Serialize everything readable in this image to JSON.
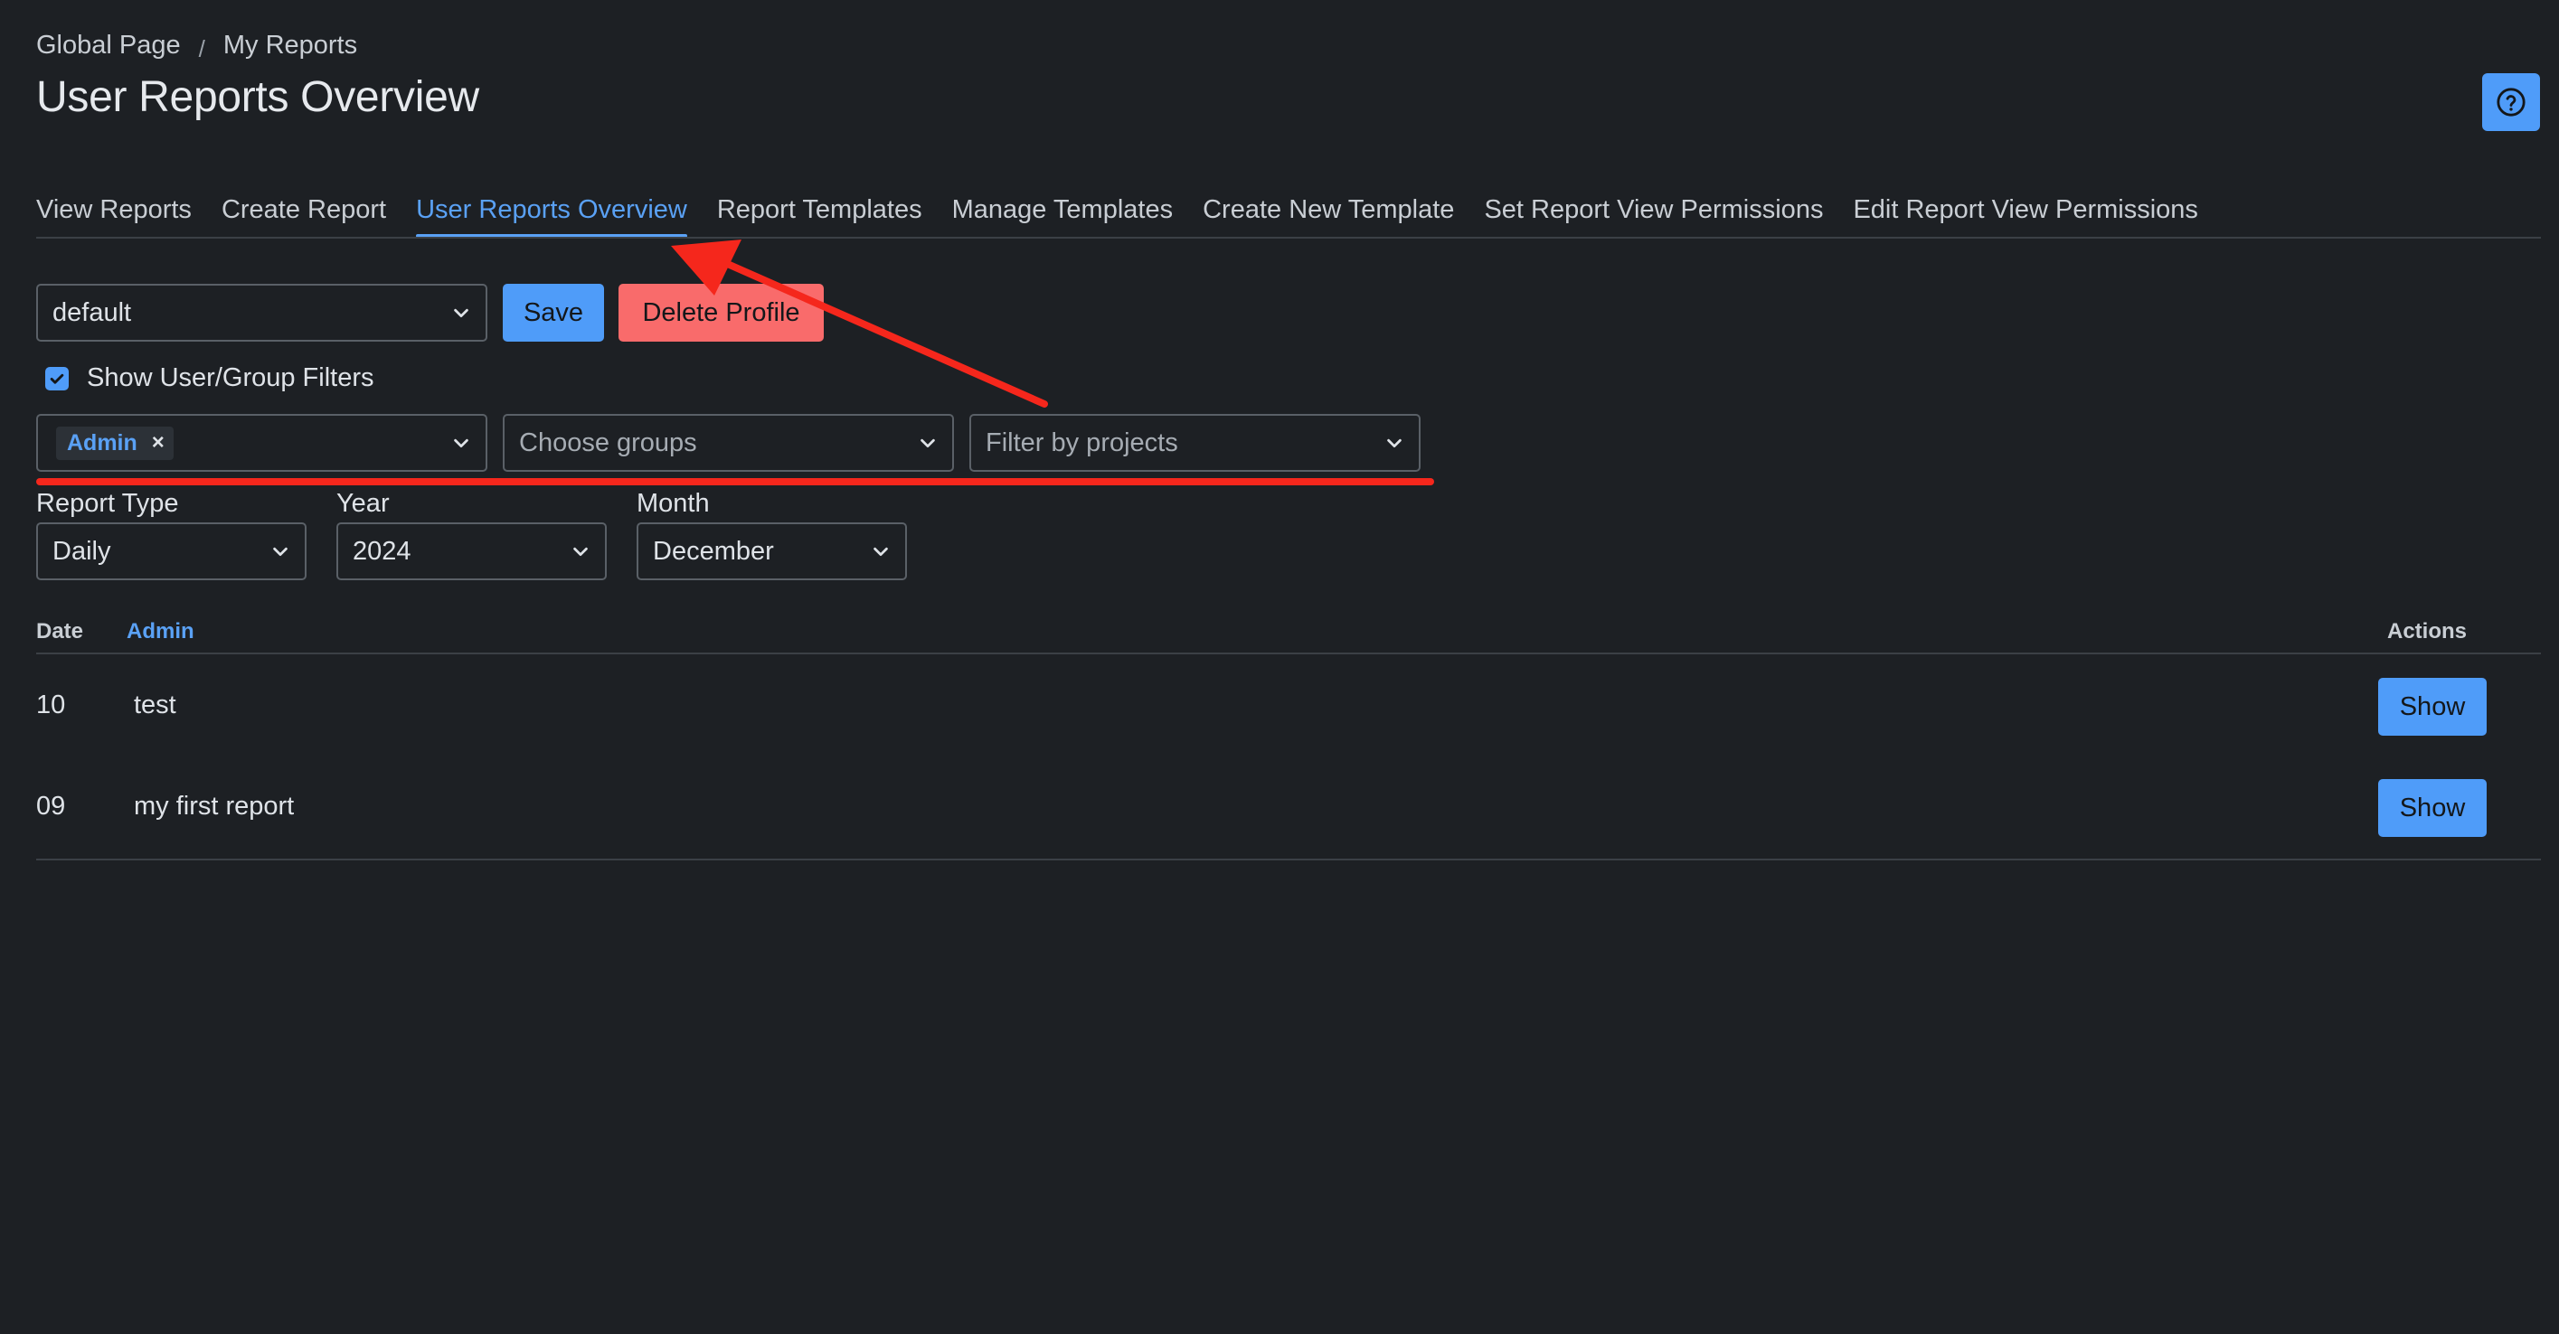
{
  "breadcrumb": {
    "items": [
      "Global Page",
      "My Reports"
    ],
    "separator": "/"
  },
  "page_title": "User Reports Overview",
  "help_icon": "question-circle-icon",
  "tabs": [
    {
      "label": "View Reports",
      "active": false
    },
    {
      "label": "Create Report",
      "active": false
    },
    {
      "label": "User Reports Overview",
      "active": true
    },
    {
      "label": "Report Templates",
      "active": false
    },
    {
      "label": "Manage Templates",
      "active": false
    },
    {
      "label": "Create New Template",
      "active": false
    },
    {
      "label": "Set Report View Permissions",
      "active": false
    },
    {
      "label": "Edit Report View Permissions",
      "active": false
    }
  ],
  "profile": {
    "selected": "default",
    "save_label": "Save",
    "delete_label": "Delete Profile"
  },
  "filters": {
    "show_filters_label": "Show User/Group Filters",
    "show_filters_checked": true,
    "users": {
      "tags": [
        "Admin"
      ],
      "remove_glyph": "×"
    },
    "groups_placeholder": "Choose groups",
    "projects_placeholder": "Filter by projects"
  },
  "report_options": {
    "type_label": "Report Type",
    "type_value": "Daily",
    "year_label": "Year",
    "year_value": "2024",
    "month_label": "Month",
    "month_value": "December"
  },
  "table": {
    "headers": {
      "date": "Date",
      "user": "Admin",
      "actions": "Actions"
    },
    "rows": [
      {
        "date": "10",
        "title": "test",
        "action": "Show"
      },
      {
        "date": "09",
        "title": "my first report",
        "action": "Show"
      }
    ]
  },
  "colors": {
    "background": "#1d2024",
    "accent": "#4f9cf9",
    "danger": "#f96b6b",
    "annotation": "#f5271c"
  }
}
